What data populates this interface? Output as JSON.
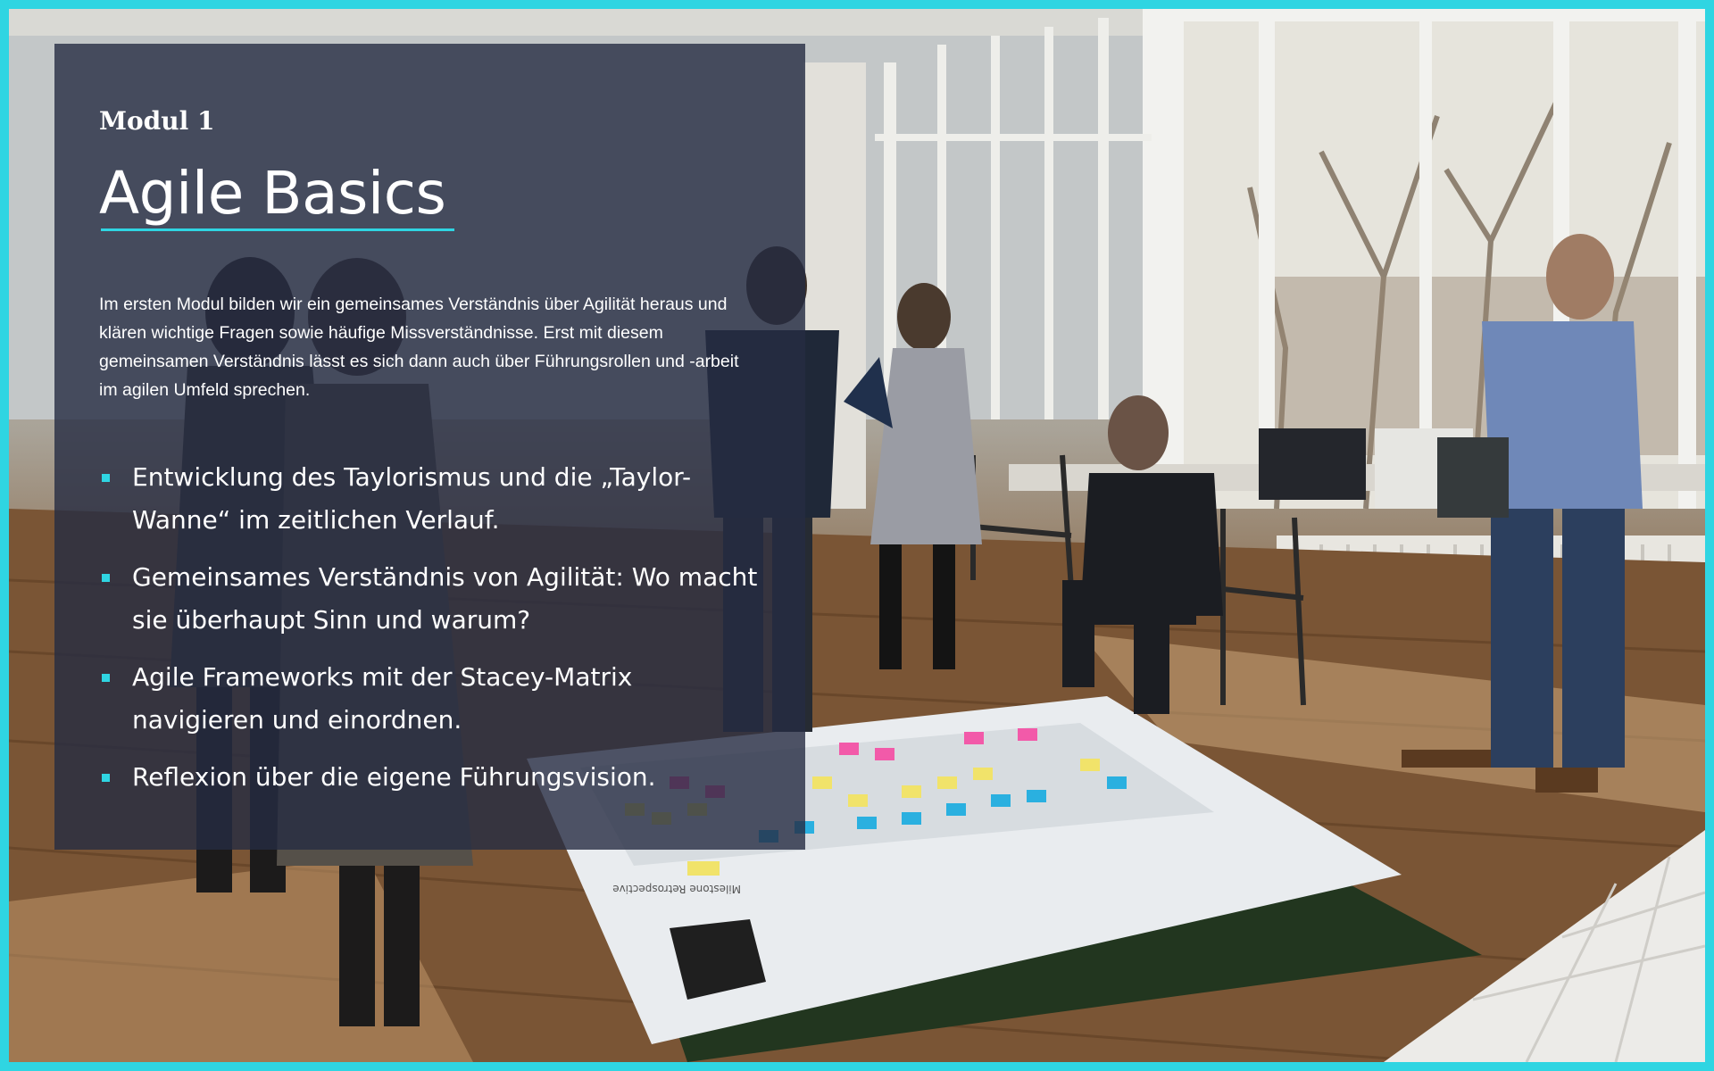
{
  "colors": {
    "accent": "#2fd5e2",
    "panel": "#262c42",
    "text": "#ffffff"
  },
  "module": {
    "label": "Modul 1",
    "title": "Agile Basics",
    "intro": "Im ersten Modul bilden wir ein gemeinsames Verständnis über Agilität heraus und klären wichtige Fragen sowie häufige Missverständnisse. Erst mit diesem gemeinsamen Verständnis lässt es sich dann auch über Führungsrollen und -arbeit im agilen Umfeld sprechen.",
    "bullets": [
      "Entwicklung des Taylorismus und die „Taylor-Wanne“ im zeitlichen Verlauf.",
      "Gemeinsames Verständnis von Agilität: Wo macht sie überhaupt Sinn und warum?",
      "Agile Frameworks mit der Stacey-Matrix navigieren und einordnen.",
      "Reflexion über die eigene Führungsvision."
    ]
  },
  "photo": {
    "board_text": "Milestone Retrospective"
  }
}
